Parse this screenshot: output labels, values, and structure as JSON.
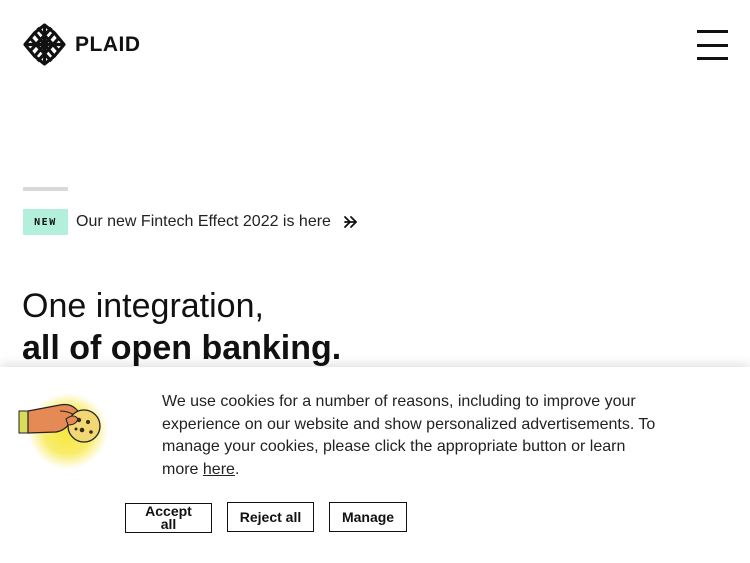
{
  "header": {
    "logo_text": "PLAID",
    "menu_icon": "hamburger-menu-icon"
  },
  "announcement": {
    "badge": "NEW",
    "text": "Our new Fintech Effect 2022 is here",
    "arrow_icon": "double-chevron-right-icon"
  },
  "hero": {
    "line1": "One integration,",
    "line2": "all of open banking."
  },
  "cookie_banner": {
    "illustration_icon": "hand-holding-cookie-icon",
    "text": "We use cookies for a number of reasons, including to improve your experience on our website and show personalized advertisements. To manage your cookies, please click the appropriate button or learn more",
    "link_text": "here",
    "period": ".",
    "buttons": {
      "accept": "Accept all",
      "reject": "Reject all",
      "manage": "Manage"
    }
  },
  "colors": {
    "badge_bg": "#b2f0dc",
    "text": "#111111",
    "cookie_glow": "#f6e63a"
  }
}
